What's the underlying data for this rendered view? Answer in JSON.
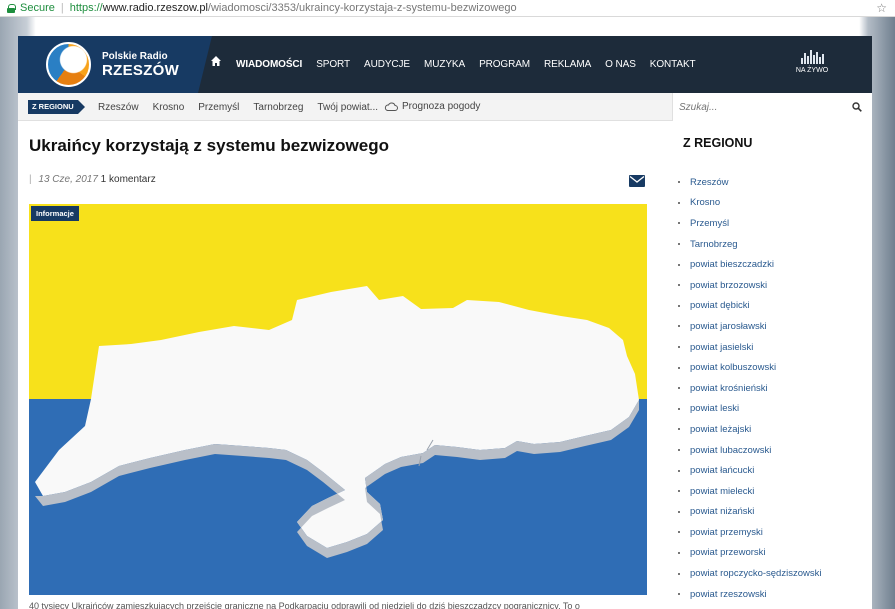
{
  "browser": {
    "secure_label": "Secure",
    "url_scheme": "https://",
    "url_host": "www.radio.rzeszow.pl",
    "url_path": "/wiadomosci/3353/ukraincy-korzystaja-z-systemu-bezwizowego"
  },
  "header": {
    "logo_line1": "Polskie Radio",
    "logo_line2": "RZESZÓW",
    "nav": [
      "WIADOMOŚCI",
      "SPORT",
      "AUDYCJE",
      "MUZYKA",
      "PROGRAM",
      "REKLAMA",
      "O NAS",
      "KONTAKT"
    ],
    "live_label": "NA ŻYWO"
  },
  "subbar": {
    "region_badge": "Z REGIONU",
    "links": [
      "Rzeszów",
      "Krosno",
      "Przemyśl",
      "Tarnobrzeg",
      "Twój powiat..."
    ],
    "weather_label": "Prognoza pogody",
    "search_placeholder": "Szukaj..."
  },
  "article": {
    "title": "Ukraińcy korzystają z systemu bezwizowego",
    "date": "13 Cze, 2017",
    "comments": "1 komentarz",
    "category": "Informacje",
    "teaser": "40 tysięcy Ukraińców zamieszkujących przejście graniczne na Podkarpaciu odprawili od niedzieli do dziś bieszczadzcy pogranicznicy. To o"
  },
  "sidebar": {
    "title": "Z REGIONU",
    "items": [
      "Rzeszów",
      "Krosno",
      "Przemyśl",
      "Tarnobrzeg",
      "powiat bieszczadzki",
      "powiat brzozowski",
      "powiat dębicki",
      "powiat jarosławski",
      "powiat jasielski",
      "powiat kolbuszowski",
      "powiat krośnieński",
      "powiat leski",
      "powiat leżajski",
      "powiat lubaczowski",
      "powiat łańcucki",
      "powiat mielecki",
      "powiat niżański",
      "powiat przemyski",
      "powiat przeworski",
      "powiat ropczycko-sędziszowski",
      "powiat rzeszowski"
    ]
  },
  "colors": {
    "navy": "#173a63",
    "header_dark": "#1d2b3a",
    "flag_yellow": "#f7e11b",
    "flag_blue": "#2f6db5",
    "link_blue": "#2a5a8f"
  }
}
